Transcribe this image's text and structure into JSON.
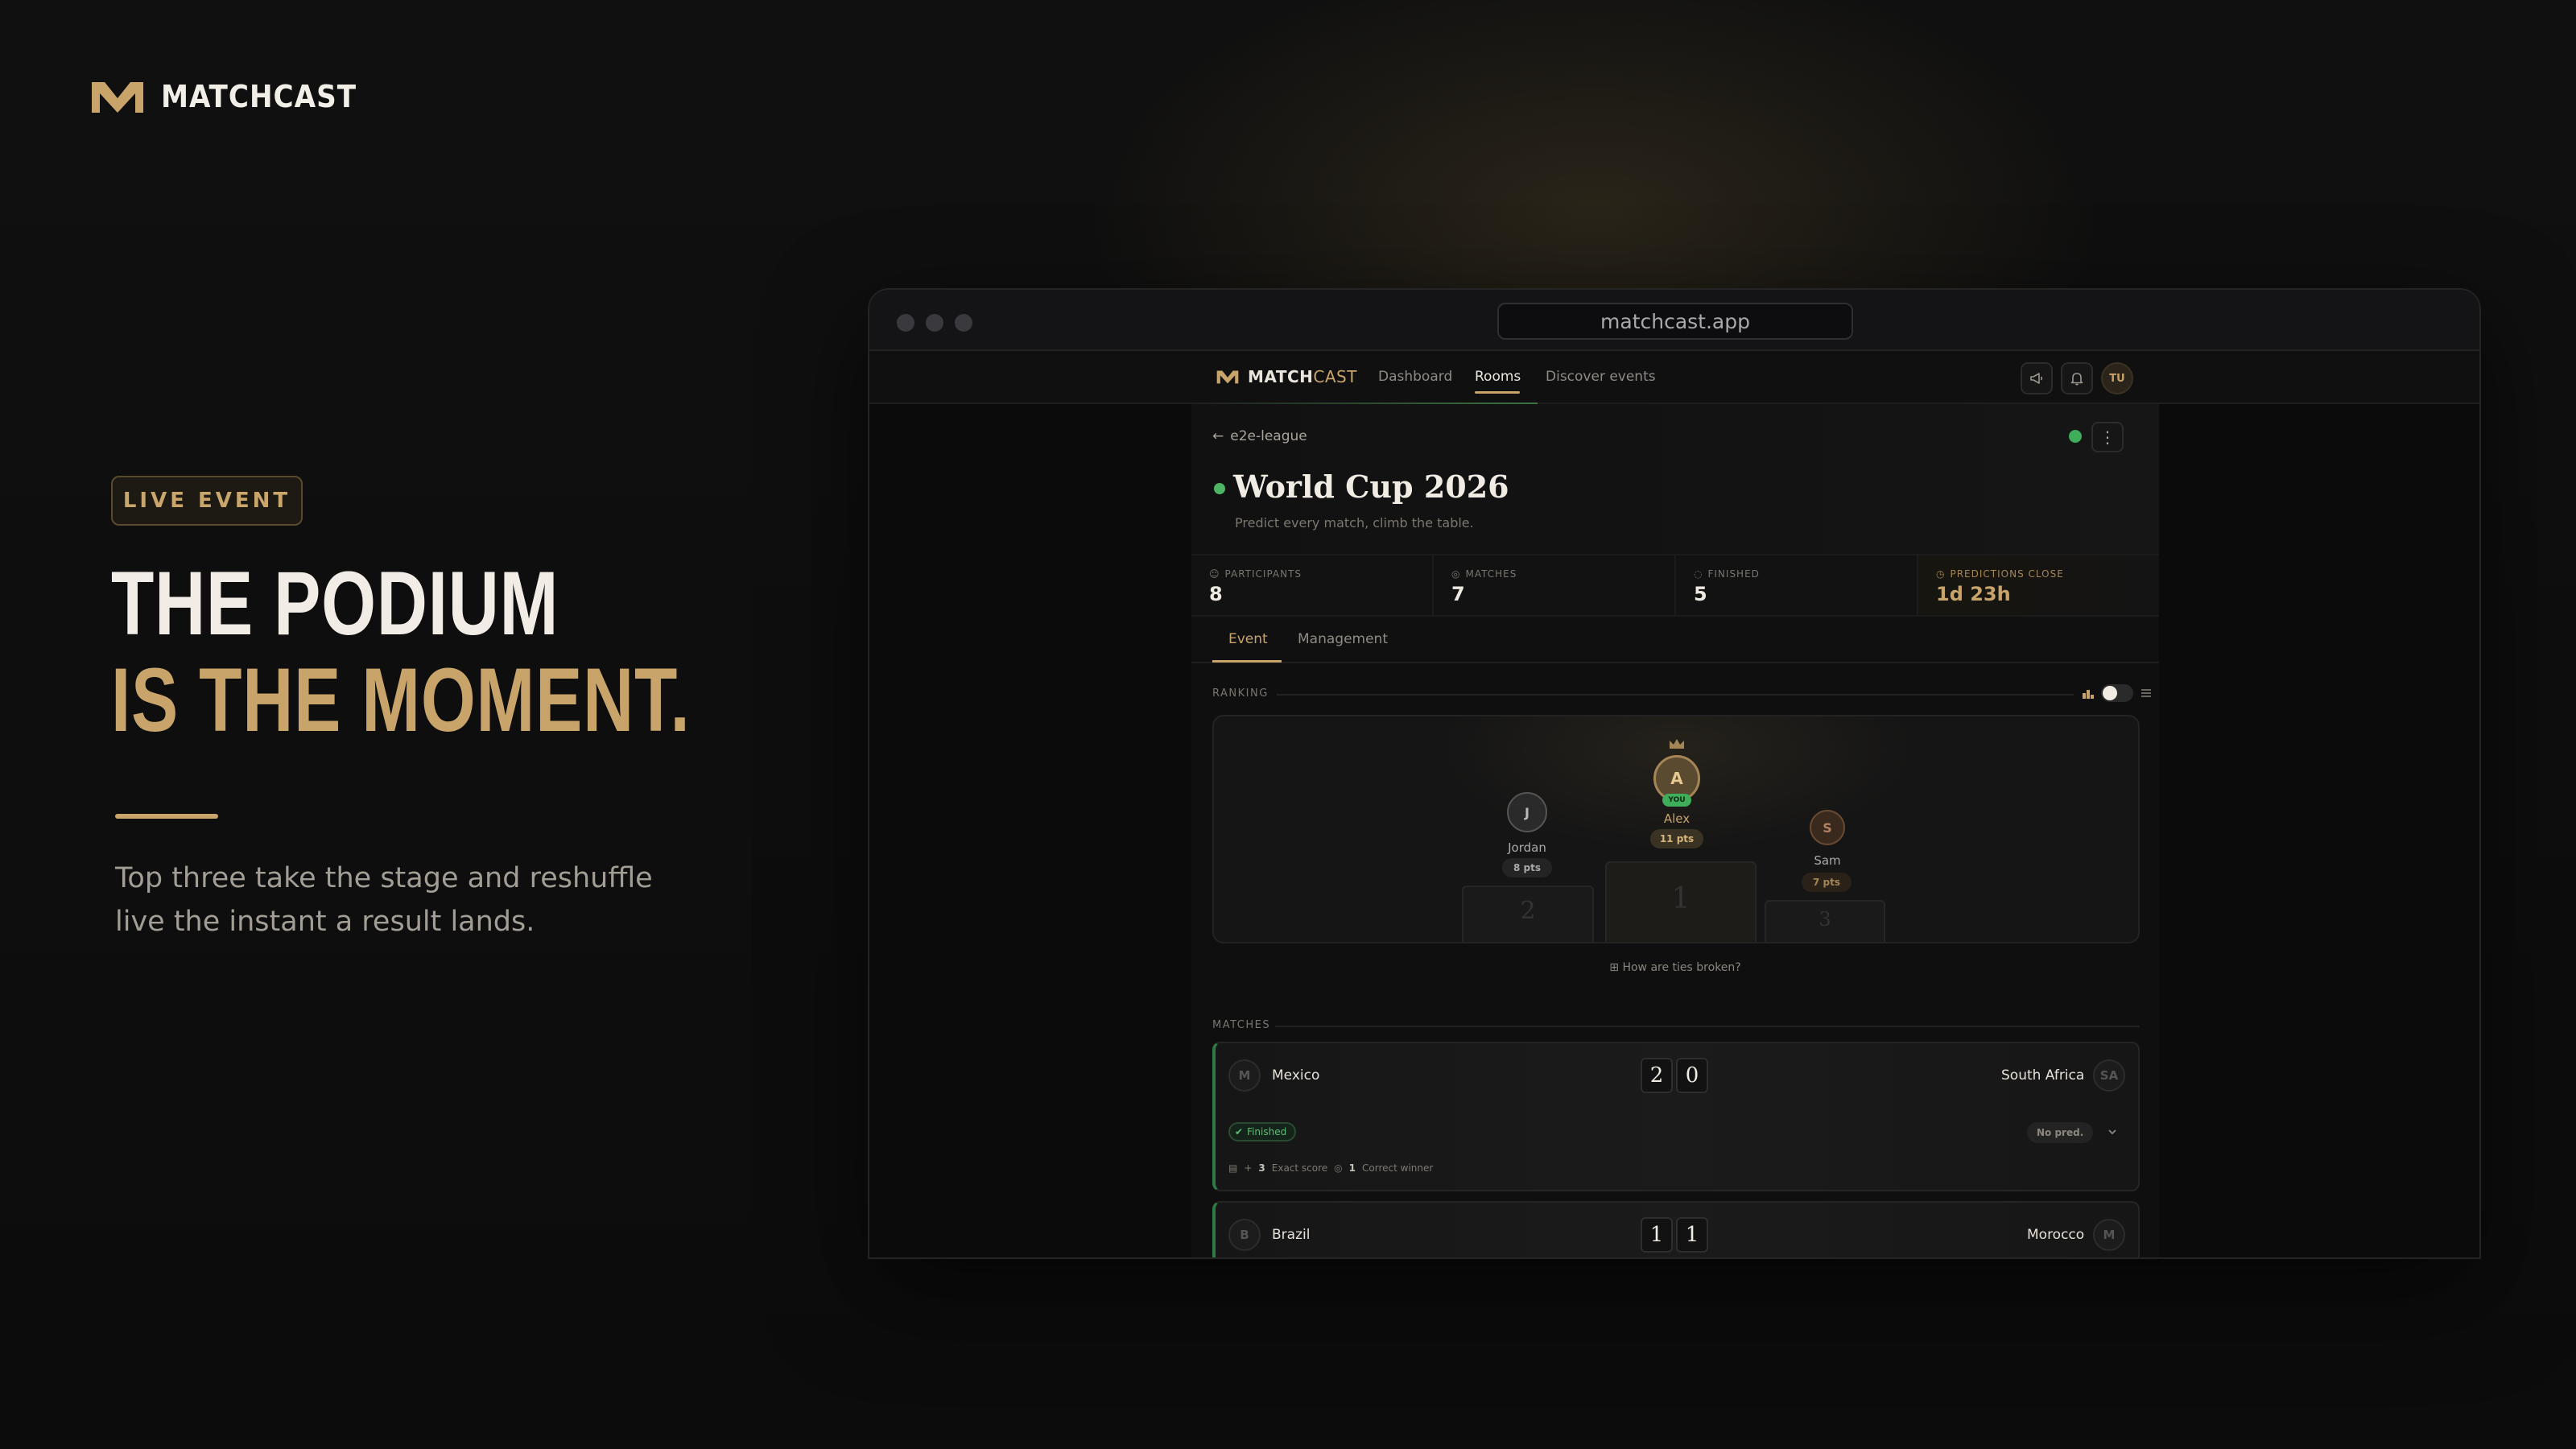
{
  "brand": {
    "name": "MATCHCAST"
  },
  "hero": {
    "badge": "LIVE EVENT",
    "headline_line1": "THE PODIUM",
    "headline_line2": "IS THE MOMENT.",
    "description": "Top three take the stage and reshuffle live the instant a result lands.",
    "accent_color": "#c8a46b"
  },
  "browser": {
    "url": "matchcast.app"
  },
  "app": {
    "logo_main": "MATCH",
    "logo_accent": "CAST",
    "nav": {
      "dashboard": "Dashboard",
      "rooms": "Rooms",
      "discover": "Discover events",
      "active": "Rooms"
    },
    "user_initials": "TU",
    "icons": [
      "megaphone-icon",
      "bell-icon"
    ]
  },
  "event": {
    "breadcrumb": "e2e-league",
    "title": "World Cup 2026",
    "subtitle": "Predict every match, climb the table.",
    "stats": {
      "participants_label": "PARTICIPANTS",
      "participants_value": "8",
      "matches_label": "MATCHES",
      "matches_value": "7",
      "finished_label": "FINISHED",
      "finished_value": "5",
      "close_label": "PREDICTIONS CLOSE",
      "close_value": "1d 23h"
    },
    "tabs": {
      "event": "Event",
      "management": "Management",
      "active": "Event"
    }
  },
  "ranking": {
    "label": "RANKING",
    "first": {
      "initial": "A",
      "name": "Alex",
      "points": "11 pts",
      "tag": "YOU",
      "place": "1"
    },
    "second": {
      "initial": "J",
      "name": "Jordan",
      "points": "8 pts",
      "place": "2"
    },
    "third": {
      "initial": "S",
      "name": "Sam",
      "points": "7 pts",
      "place": "3"
    },
    "ties_link": "How are ties broken?"
  },
  "matches": {
    "label": "MATCHES",
    "items": [
      {
        "home": "Mexico",
        "home_initial": "M",
        "away": "South Africa",
        "away_initial": "SA",
        "home_score": "2",
        "away_score": "0",
        "status": "Finished",
        "prediction": "No pred.",
        "exact_label": "Exact score",
        "exact_value": "3",
        "winner_label": "Correct winner",
        "winner_value": "1"
      },
      {
        "home": "Brazil",
        "home_initial": "B",
        "away": "Morocco",
        "away_initial": "M",
        "home_score": "1",
        "away_score": "1"
      }
    ]
  },
  "colors": {
    "gold": "#c8a46b",
    "success": "#3fae5a",
    "background": "#0c0c0c"
  }
}
